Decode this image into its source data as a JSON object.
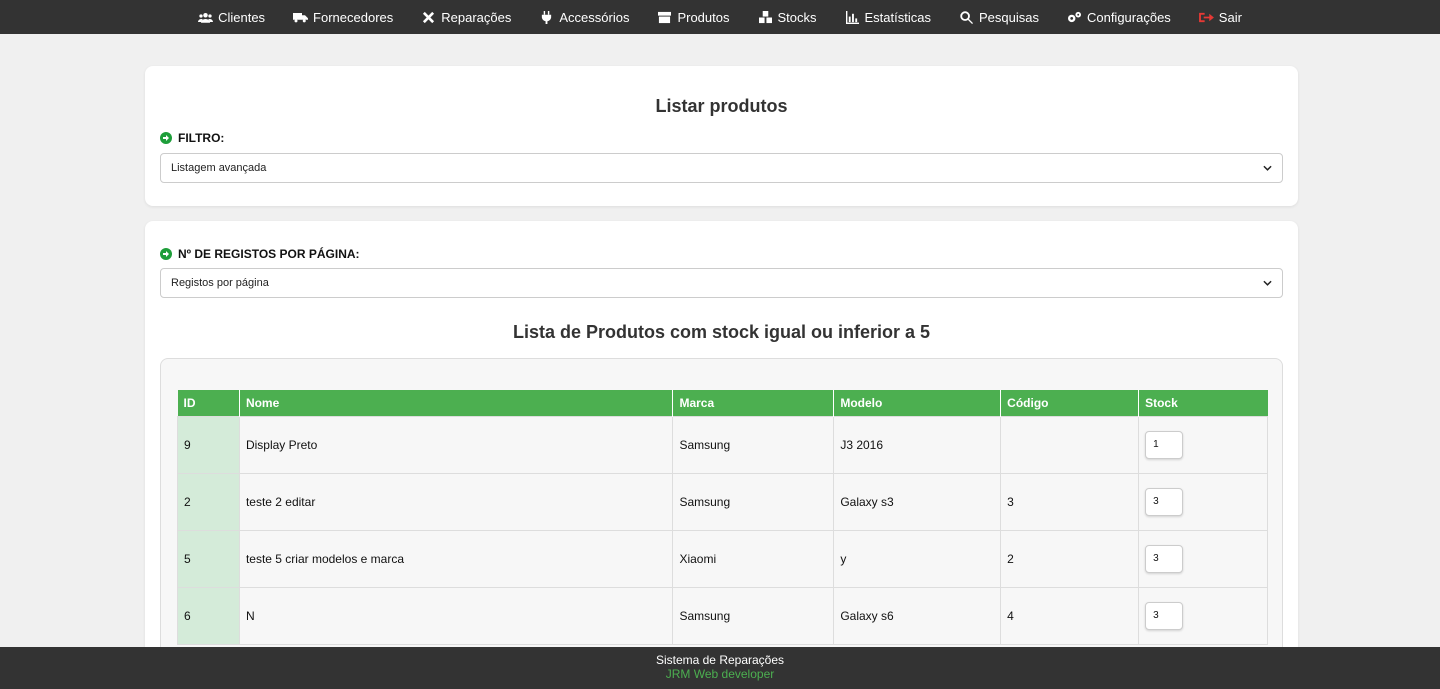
{
  "nav": [
    {
      "label": "Clientes",
      "icon": "users-icon"
    },
    {
      "label": "Fornecedores",
      "icon": "truck-icon"
    },
    {
      "label": "Reparações",
      "icon": "tools-icon"
    },
    {
      "label": "Accessórios",
      "icon": "plug-icon"
    },
    {
      "label": "Produtos",
      "icon": "box-icon"
    },
    {
      "label": "Stocks",
      "icon": "boxes-icon"
    },
    {
      "label": "Estatísticas",
      "icon": "chart-icon"
    },
    {
      "label": "Pesquisas",
      "icon": "search-icon"
    },
    {
      "label": "Configurações",
      "icon": "gears-icon"
    },
    {
      "label": "Sair",
      "icon": "sign-out-icon"
    }
  ],
  "filter_card": {
    "title": "Listar produtos",
    "filter_label": "FILTRO:",
    "filter_value": "Listagem avançada"
  },
  "list_card": {
    "per_page_label": "Nº DE REGISTOS POR PÁGINA:",
    "per_page_value": "Registos por página",
    "title": "Lista de Produtos com stock igual ou inferior a 5",
    "table": {
      "headers": [
        "ID",
        "Nome",
        "Marca",
        "Modelo",
        "Código",
        "Stock"
      ],
      "rows": [
        {
          "id": "9",
          "nome": "Display Preto",
          "marca": "Samsung",
          "modelo": "J3 2016",
          "codigo": "",
          "stock": "1"
        },
        {
          "id": "2",
          "nome": "teste 2 editar",
          "marca": "Samsung",
          "modelo": "Galaxy s3",
          "codigo": "3",
          "stock": "3"
        },
        {
          "id": "5",
          "nome": "teste 5 criar modelos e marca",
          "marca": "Xiaomi",
          "modelo": "y",
          "codigo": "2",
          "stock": "3"
        },
        {
          "id": "6",
          "nome": "N",
          "marca": "Samsung",
          "modelo": "Galaxy s6",
          "codigo": "4",
          "stock": "3"
        }
      ]
    }
  },
  "footer": {
    "line1": "Sistema de Reparações",
    "line2": "JRM Web developer"
  },
  "colors": {
    "nav_bg": "#333333",
    "header_green": "#4caf50",
    "id_cell_bg": "#d4ebd9",
    "logout_red": "#e53935",
    "label_dot": "#1e9e3a"
  }
}
